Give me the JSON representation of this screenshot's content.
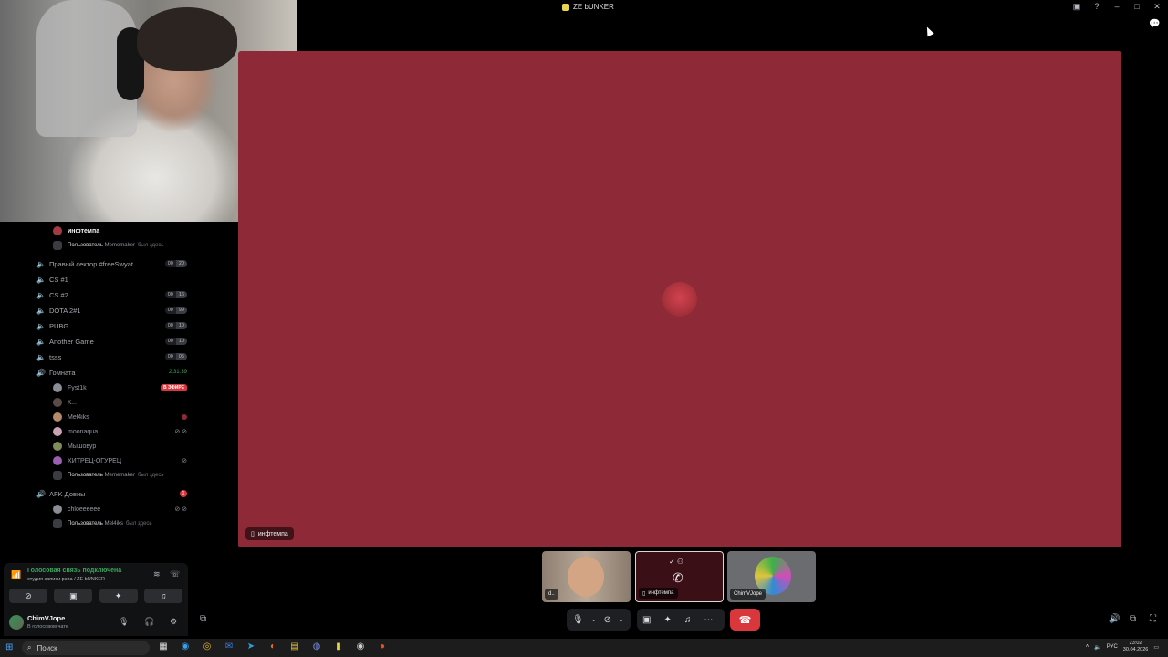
{
  "window": {
    "title": "ZE bUNKER"
  },
  "sidebar": {
    "top_user": {
      "name": "инфтемпа"
    },
    "notice1": {
      "prefix": "Пользователь",
      "name": "Mememaker",
      "suffix": "был здесь"
    },
    "channels": [
      {
        "name": "Правый сектор #freeSwyat",
        "a": "00",
        "b": "20"
      },
      {
        "name": "CS #1"
      },
      {
        "name": "CS #2",
        "a": "00",
        "b": "16"
      },
      {
        "name": "DOTA 2#1",
        "a": "00",
        "b": "99"
      },
      {
        "name": "PUBG",
        "a": "00",
        "b": "10"
      },
      {
        "name": "Another Game",
        "a": "00",
        "b": "10"
      },
      {
        "name": "tsss",
        "a": "00",
        "b": "05"
      },
      {
        "name": "Гомната",
        "timer": "2:31:39"
      }
    ],
    "gomnata_users": [
      {
        "name": "Fyst1k",
        "badge": "В ЭФИРЕ"
      },
      {
        "name": "К..."
      },
      {
        "name": "Mel4iks"
      },
      {
        "name": "moonaqua"
      },
      {
        "name": "Мышовур"
      },
      {
        "name": "ХИТРЕЦ-ОГУРЕЦ"
      }
    ],
    "notice2": {
      "prefix": "Пользователь",
      "name": "Mememaker",
      "suffix": "был здесь"
    },
    "afk": {
      "name": "AFK Довны",
      "badge": "1"
    },
    "afk_user": {
      "name": "chloeeeeee"
    },
    "notice3": {
      "prefix": "Пользователь",
      "name": "Mel4iks",
      "suffix": "был здесь"
    }
  },
  "voice_panel": {
    "status": "Голосовая связь подключена",
    "sub": "студия записи рэпа / ZE bUNKER"
  },
  "user_panel": {
    "name": "ChimVJope",
    "status": "В голосовом чате"
  },
  "stage": {
    "label": "инфтемпа"
  },
  "thumbs": [
    {
      "label": "d.."
    },
    {
      "label": "инфтемпа"
    },
    {
      "label": "ChimVJope"
    }
  ],
  "taskbar": {
    "search_placeholder": "Поиск",
    "lang": "РУС",
    "time": "23:02",
    "date": "30.04.2026"
  },
  "icons": [
    "speaker-icon",
    "microphone-icon",
    "headphones-icon",
    "settings-icon",
    "phone-icon",
    "camera-icon",
    "screen-share-icon",
    "activities-icon",
    "soundboard-icon",
    "more-icon",
    "fullscreen-icon",
    "chat-icon"
  ]
}
